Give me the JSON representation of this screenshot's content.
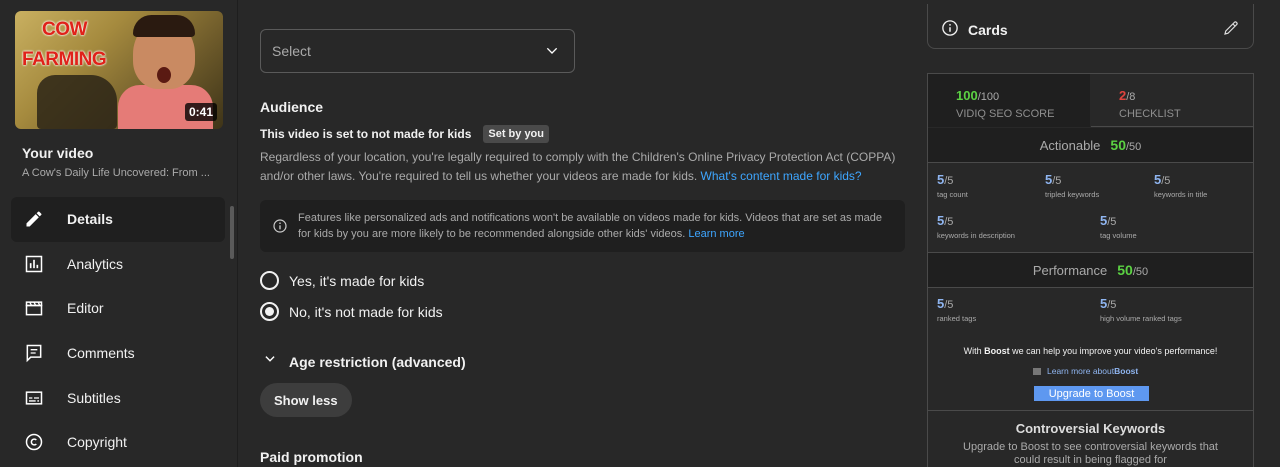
{
  "sidebar": {
    "thumbnail": {
      "title_line1": "COW",
      "title_line2": "FARMING",
      "duration": "0:41"
    },
    "your_video_label": "Your video",
    "video_title": "A Cow's Daily Life Uncovered: From ...",
    "items": [
      {
        "label": "Details",
        "icon": "pencil-icon",
        "active": true
      },
      {
        "label": "Analytics",
        "icon": "analytics-icon"
      },
      {
        "label": "Editor",
        "icon": "clapperboard-icon"
      },
      {
        "label": "Comments",
        "icon": "comment-icon"
      },
      {
        "label": "Subtitles",
        "icon": "subtitles-icon"
      },
      {
        "label": "Copyright",
        "icon": "copyright-icon"
      }
    ]
  },
  "main": {
    "select_placeholder": "Select",
    "audience_heading": "Audience",
    "made_for_kids_status": "This video is set to not made for kids",
    "set_by_badge": "Set by you",
    "coppa_text": "Regardless of your location, you're legally required to comply with the Children's Online Privacy Protection Act (COPPA) and/or other laws. You're required to tell us whether your videos are made for kids.",
    "coppa_link": "What's content made for kids?",
    "info_text": "Features like personalized ads and notifications won't be available on videos made for kids. Videos that are set as made for kids by you are more likely to be recommended alongside other kids' videos.",
    "info_link": "Learn more",
    "radio_yes": "Yes, it's made for kids",
    "radio_no": "No, it's not made for kids",
    "selected_option": "no",
    "age_restriction": "Age restriction (advanced)",
    "show_less": "Show less",
    "paid_promotion": "Paid promotion"
  },
  "right": {
    "cards_label": "Cards",
    "vidiq": {
      "seo_score": "100",
      "seo_score_max": "/100",
      "seo_label": "VIDIQ SEO SCORE",
      "checklist_score": "2",
      "checklist_max": "/8",
      "checklist_label": "CHECKLIST",
      "actionable_label": "Actionable",
      "actionable_score": "50",
      "actionable_max": "/50",
      "actionable_metrics": [
        {
          "value": "5",
          "max": "/5",
          "label": "tag count"
        },
        {
          "value": "5",
          "max": "/5",
          "label": "tripled keywords"
        },
        {
          "value": "5",
          "max": "/5",
          "label": "keywords in title"
        },
        {
          "value": "5",
          "max": "/5",
          "label": "keywords in description"
        },
        {
          "value": "5",
          "max": "/5",
          "label": "tag volume"
        }
      ],
      "performance_label": "Performance",
      "performance_score": "50",
      "performance_max": "/50",
      "performance_metrics": [
        {
          "value": "5",
          "max": "/5",
          "label": "ranked tags"
        },
        {
          "value": "5",
          "max": "/5",
          "label": "high volume ranked tags"
        }
      ],
      "boost_text_pre": "With ",
      "boost_text_bold": "Boost",
      "boost_text_post": " we can help you improve your video's performance!",
      "learn_more_pre": "Learn more about ",
      "learn_more_bold": "Boost",
      "upgrade_button": "Upgrade to Boost",
      "controversial_heading": "Controversial Keywords",
      "controversial_text": "Upgrade to Boost to see controversial keywords that could result in being flagged for"
    }
  },
  "colors": {
    "background": "#282828",
    "panel": "#1f1f1f",
    "link": "#3ea6ff",
    "score_green": "#5bd143",
    "score_red": "#e0443e",
    "metric_blue": "#8fb5f0",
    "boost_button": "#5e98f0"
  }
}
